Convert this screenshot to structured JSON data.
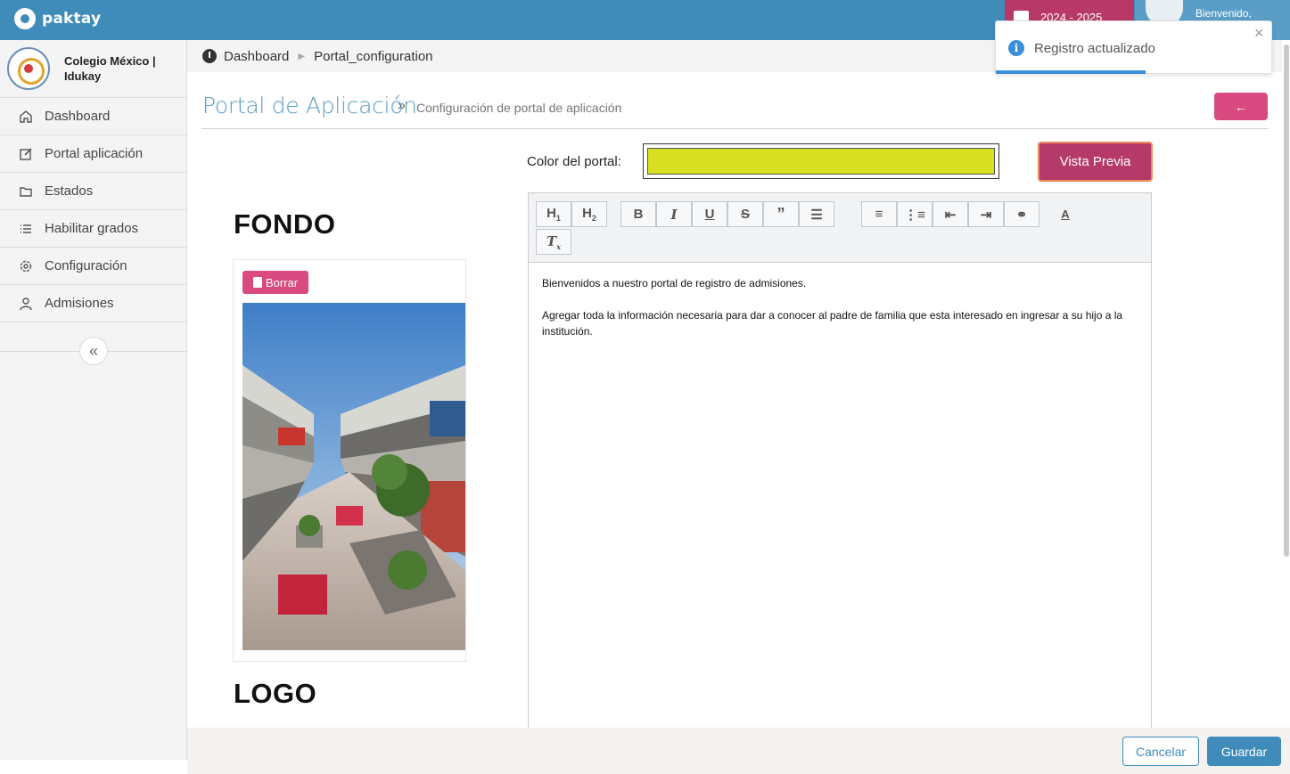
{
  "app": {
    "brand": "paktay"
  },
  "topbar": {
    "year_label": "2024 - 2025",
    "user_greeting": "Bienvenido,"
  },
  "sidebar": {
    "school_name": "Colegio México | Idukay",
    "items": [
      {
        "label": "Dashboard",
        "icon": "home-icon"
      },
      {
        "label": "Portal aplicación",
        "icon": "edit-icon"
      },
      {
        "label": "Estados",
        "icon": "folder-icon"
      },
      {
        "label": "Habilitar grados",
        "icon": "list-icon"
      },
      {
        "label": "Configuración",
        "icon": "gear-icon"
      },
      {
        "label": "Admisiones",
        "icon": "user-icon"
      }
    ]
  },
  "breadcrumb": {
    "items": [
      "Dashboard",
      "Portal_configuration"
    ]
  },
  "page": {
    "title": "Portal de Aplicación",
    "separator": "»",
    "subtitle": "Configuración de portal de aplicación",
    "back_label": "←"
  },
  "portal": {
    "color_label": "Color del portal:",
    "color_value": "#d9e021",
    "preview_label": "Vista Previa"
  },
  "sections": {
    "fondo": "FONDO",
    "logo": "LOGO",
    "delete_label": "Borrar"
  },
  "editor": {
    "toolbar": [
      "H1",
      "H2",
      "B",
      "I",
      "U",
      "S",
      "quote",
      "align",
      "ordered-list",
      "bullet-list",
      "outdent",
      "indent",
      "link",
      "text-color",
      "clear-format"
    ],
    "paragraphs": [
      "Bienvenidos a nuestro portal de registro de admisiones.",
      "",
      "Agregar toda la información necesaria para dar a conocer al padre de familia que esta interesado en ingresar a su hijo a la institución."
    ]
  },
  "toast": {
    "message": "Registro actualizado",
    "close": "×"
  },
  "footer": {
    "cancel_label": "Cancelar",
    "save_label": "Guardar"
  },
  "colors": {
    "primary": "#3f8cbb",
    "accent": "#d94a80",
    "preview": "#b53a6a",
    "toast_info": "#3a8fd8"
  }
}
